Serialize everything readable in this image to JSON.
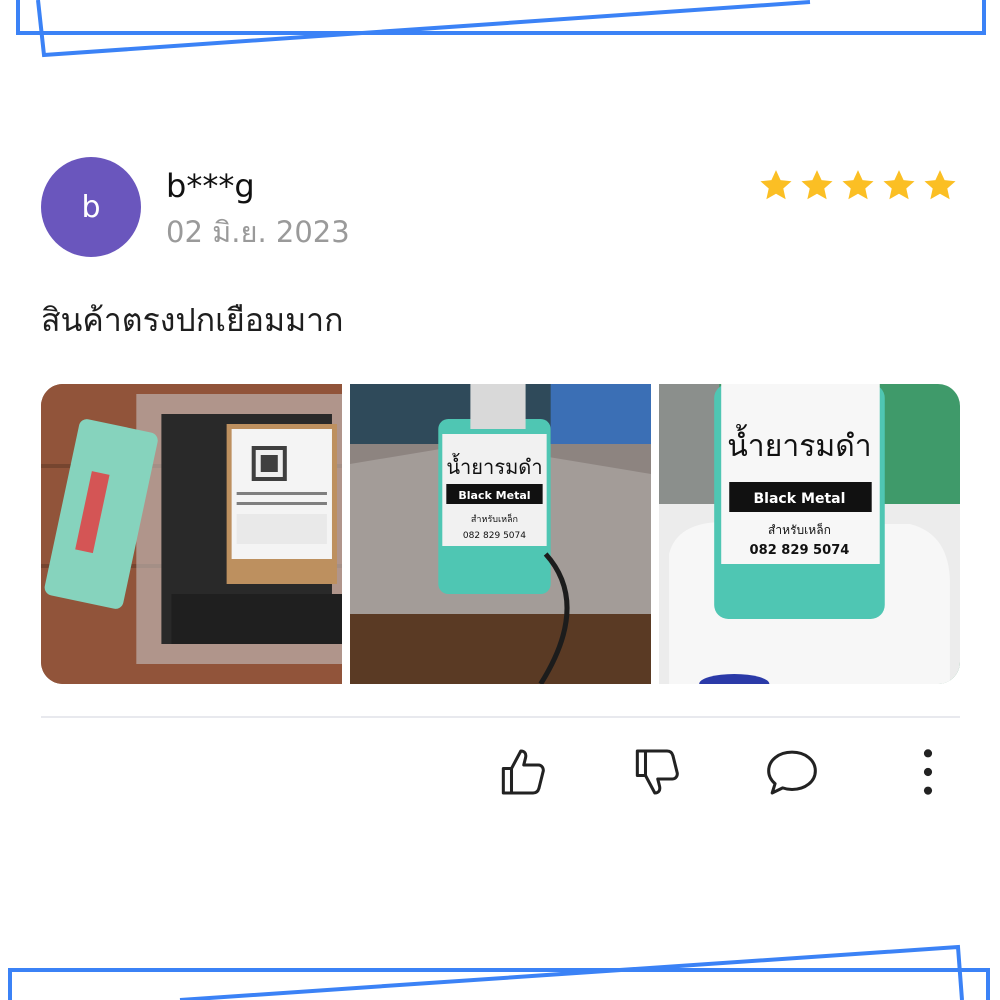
{
  "review": {
    "avatar_letter": "b",
    "username": "b***g",
    "date": "02 มิ.ย. 2023",
    "rating": 5,
    "comment": "สินค้าตรงปกเยือมมาก"
  },
  "colors": {
    "frame": "#3b82f6",
    "avatar": "#6a56bd",
    "star": "#fbbf24",
    "date": "#9a9a9a"
  },
  "photos": [
    {
      "label_icon": "package-photo"
    },
    {
      "label_icon": "bottle-photo",
      "title": "น้ำยารมดำ",
      "brand": "Black Metal",
      "sub": "สำหรับเหล็ก",
      "phone": "082 829 5074"
    },
    {
      "label_icon": "bottle-closeup-photo",
      "title": "น้ำยารมดำ",
      "brand": "Black Metal",
      "sub": "สำหรับเหล็ก",
      "phone": "082 829 5074"
    }
  ],
  "actions": [
    "thumbs-up-icon",
    "thumbs-down-icon",
    "comment-icon",
    "more-icon"
  ]
}
